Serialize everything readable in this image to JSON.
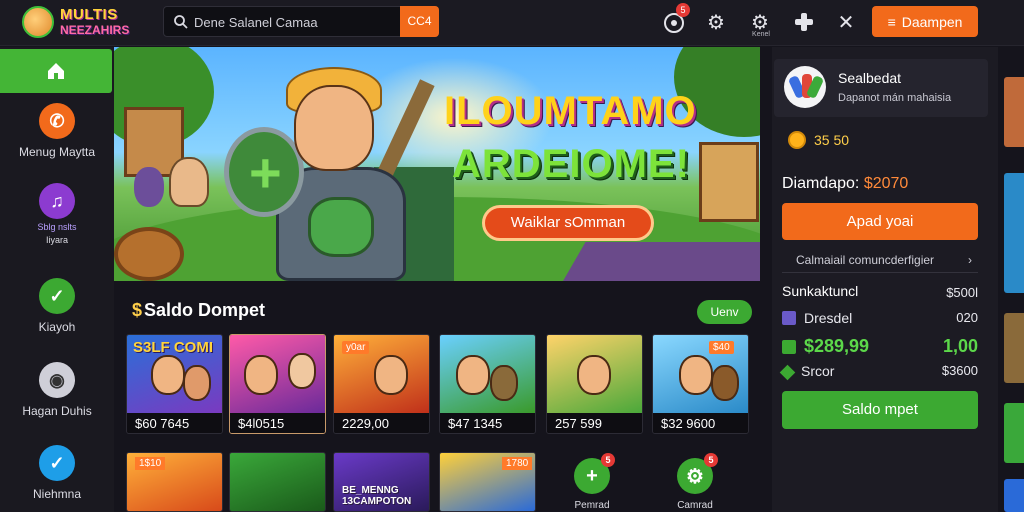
{
  "header": {
    "logo_line1": "MULTIS",
    "logo_line2": "NEEZAHIRS",
    "search_placeholder": "Dene Salanel Camaa",
    "search_button": "CC4",
    "notif_badge": "5",
    "settings_sub": "Kenel",
    "primary_button": "Daampen",
    "accent_color": "#f26a1b",
    "icons": [
      "search-icon",
      "bell-icon",
      "gear-icon",
      "settings-icon",
      "gamepad-icon",
      "close-icon",
      "menu-icon"
    ]
  },
  "sidebar": {
    "items": [
      {
        "label": "Menug Maytta",
        "icon": "call-icon",
        "color": "#f26a1b"
      },
      {
        "label": "Sblg nslts",
        "label2": "Iiyara",
        "icon": "music-icon",
        "color": "#8c3bd0"
      },
      {
        "label": "Kiayoh",
        "icon": "check-icon",
        "color": "#3ca932"
      },
      {
        "label": "Hagan Duhis",
        "icon": "disc-icon",
        "color": "#cfcfd8"
      },
      {
        "label": "Niehmna",
        "icon": "checkmark-icon",
        "color": "#1e9ee8"
      }
    ]
  },
  "hero": {
    "title_line1": "ILOUMTAMO",
    "title_line2": "ARDEIOME!",
    "cta": "Waiklar sOmman"
  },
  "games": {
    "title": "Saldo Dompet",
    "view_button": "Uenv",
    "cards": [
      {
        "price": "$60 7645",
        "caption": "S3LF COMI",
        "tag": ""
      },
      {
        "price": "$4l0515",
        "caption": "",
        "tag": ""
      },
      {
        "price": "2229,00",
        "caption": "",
        "tag": "y0ar"
      },
      {
        "price": "$47 1345",
        "caption": "",
        "tag": ""
      },
      {
        "price": "257 599",
        "caption": "",
        "tag": ""
      },
      {
        "price": "$32 9600",
        "caption": "",
        "tag": "$40"
      }
    ],
    "row2": [
      {
        "tag": "1$10",
        "caption": ""
      },
      {
        "tag": "",
        "caption": ""
      },
      {
        "tag": "",
        "caption": "BE_MENNG 13CAMPOTON"
      },
      {
        "tag": "1780",
        "caption": ""
      }
    ],
    "mini": [
      {
        "label": "Pemrad",
        "badge": "5",
        "icon": "plus-icon"
      },
      {
        "label": "Camrad",
        "badge": "5",
        "icon": "gear-icon"
      }
    ]
  },
  "wallet": {
    "user_name": "Sealbedat",
    "user_sub": "Dapanot mán mahaisia",
    "coins": "35 50",
    "deposit_label": "Diamdapo:",
    "deposit_amount": "$2070",
    "deposit_button": "Apad yoai",
    "menu_link": "Calmaiail comuncderfigier",
    "summary_title": "Sunkaktuncl",
    "summary_value": "$500l",
    "rows": [
      {
        "label": "Dresdel",
        "value": "020",
        "icon": "card-icon",
        "color": "#e8e8ee"
      },
      {
        "label": "$289,99",
        "value": "1,00",
        "icon": "money-icon",
        "color": "#5cd84a"
      },
      {
        "label": "Srcor",
        "value": "$3600",
        "icon": "gem-icon",
        "color": "#e8e8ee"
      }
    ],
    "green_button": "Saldo mpet"
  }
}
